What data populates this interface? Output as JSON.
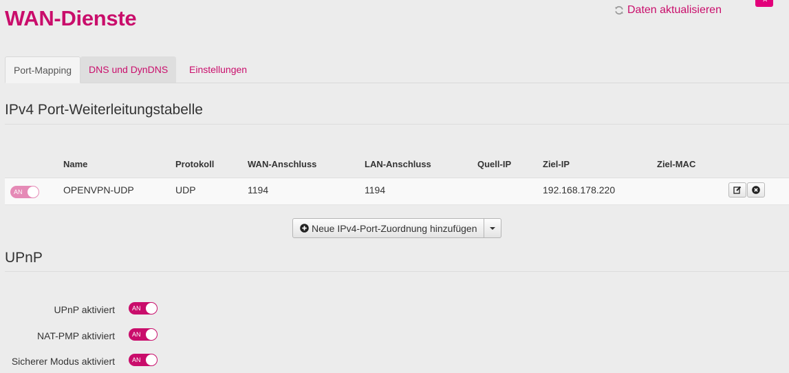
{
  "header": {
    "title": "WAN-Dienste",
    "refresh_label": "Daten aktualisieren",
    "refresh_icon": "refresh-icon",
    "corner_button_icon": "close-icon",
    "accent_color": "#c90d6b"
  },
  "tabs": [
    {
      "label": "Port-Mapping",
      "active": true
    },
    {
      "label": "DNS und DynDNS",
      "active": false
    },
    {
      "label": "Einstellungen",
      "active": false
    }
  ],
  "ipv4": {
    "section_title": "IPv4 Port-Weiterleitungstabelle",
    "columns": [
      "Name",
      "Protokoll",
      "WAN-Anschluss",
      "LAN-Anschluss",
      "Quell-IP",
      "Ziel-IP",
      "Ziel-MAC"
    ],
    "rows": [
      {
        "toggle": "AN",
        "name": "OPENVPN-UDP",
        "protocol": "UDP",
        "wan_port": "1194",
        "lan_port": "1194",
        "source_ip": "",
        "target_ip": "192.168.178.220",
        "target_mac": "",
        "edit_icon": "edit-icon",
        "delete_icon": "delete-icon"
      }
    ],
    "add_button_label": "Neue IPv4-Port-Zuordnung hinzufügen",
    "add_icon": "plus-circle-icon",
    "dropdown_icon": "caret-down-icon"
  },
  "upnp": {
    "section_title": "UPnP",
    "settings": [
      {
        "label": "UPnP aktiviert",
        "toggle": "AN"
      },
      {
        "label": "NAT-PMP aktiviert",
        "toggle": "AN"
      },
      {
        "label": "Sicherer Modus aktiviert",
        "toggle": "AN"
      }
    ]
  }
}
